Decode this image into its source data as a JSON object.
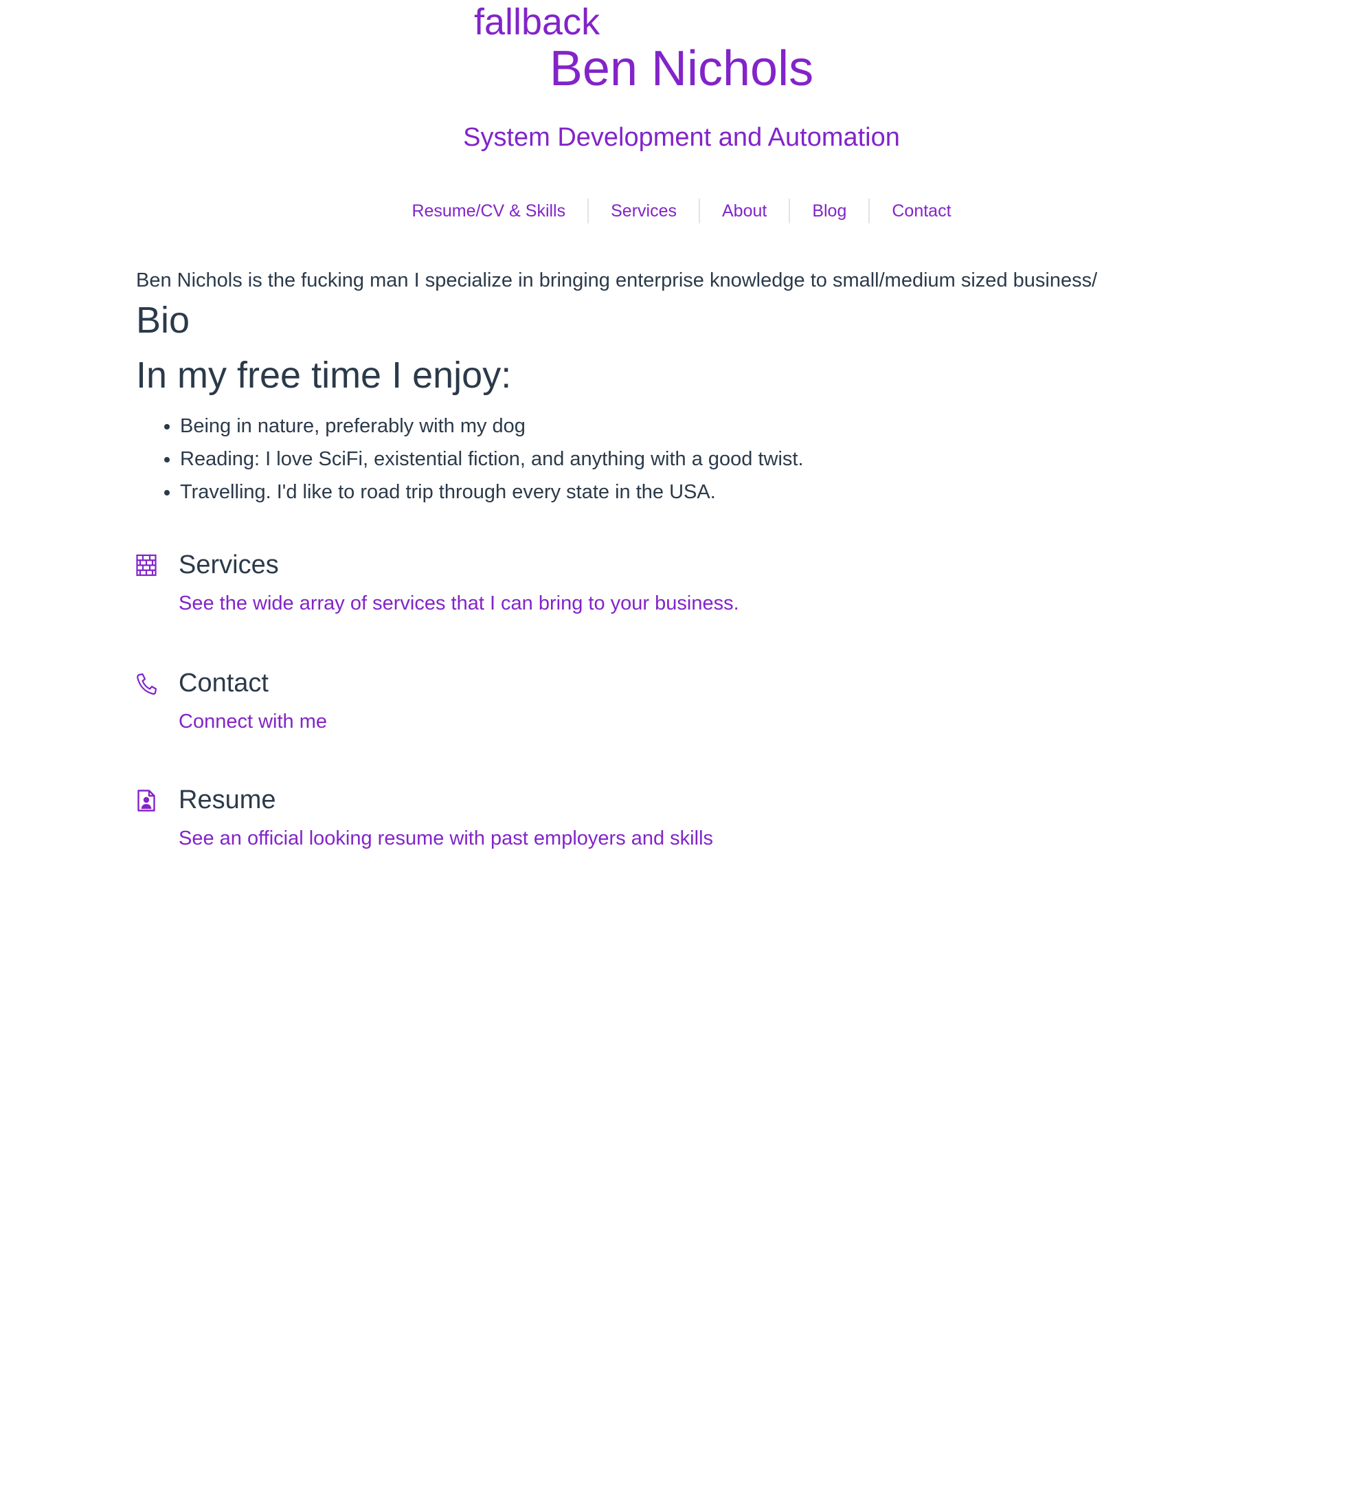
{
  "header": {
    "fallback_text": "fallback",
    "title": "Ben Nichols",
    "subtitle": "System Development and Automation"
  },
  "nav": {
    "items": [
      {
        "label": "Resume/CV & Skills"
      },
      {
        "label": "Services"
      },
      {
        "label": "About"
      },
      {
        "label": "Blog"
      },
      {
        "label": "Contact"
      }
    ]
  },
  "main": {
    "intro": "Ben Nichols is the fucking man I specialize in bringing enterprise knowledge to small/medium sized business/",
    "bio_heading": "Bio",
    "free_time_heading": "In my free time I enjoy:",
    "hobbies": [
      "Being in nature, preferably with my dog",
      "Reading: I love SciFi, existential fiction, and anything with a good twist.",
      "Travelling. I'd like to road trip through every state in the USA."
    ]
  },
  "features": [
    {
      "icon": "brick-wall-icon",
      "title": "Services",
      "link": "See the wide array of services that I can bring to your business."
    },
    {
      "icon": "phone-icon",
      "title": "Contact",
      "link": "Connect with me"
    },
    {
      "icon": "resume-document-icon",
      "title": "Resume",
      "link": "See an official looking resume with past employers and skills"
    }
  ],
  "colors": {
    "accent": "#8224c9",
    "text": "#2b3a4a",
    "divider": "#e3e3e8",
    "background": "#ffffff"
  }
}
